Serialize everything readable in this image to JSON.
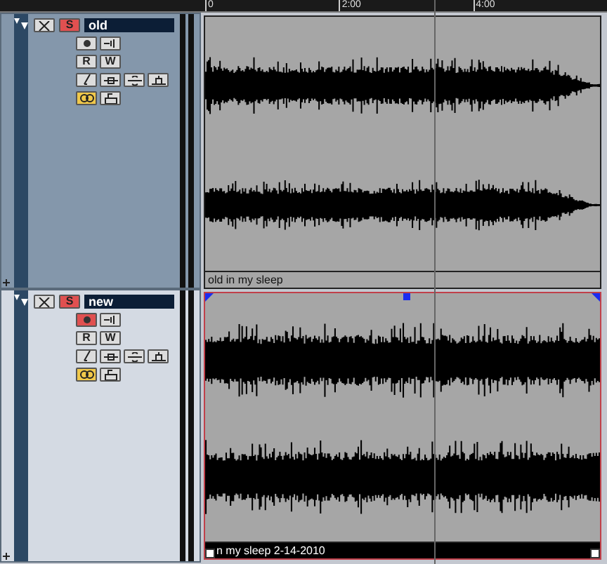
{
  "ruler": {
    "ticks": [
      {
        "label": "0"
      },
      {
        "label": "2:00"
      },
      {
        "label": "4:00"
      }
    ]
  },
  "tracks": [
    {
      "name": "old",
      "selected": false,
      "solo_label": "S",
      "read_label": "R",
      "write_label": "W",
      "record": false,
      "lanes": true,
      "event": {
        "label": "old in my sleep",
        "selected": false
      }
    },
    {
      "name": "new",
      "selected": true,
      "solo_label": "S",
      "read_label": "R",
      "write_label": "W",
      "record": true,
      "lanes": true,
      "event": {
        "label": "n my sleep 2-14-2010",
        "selected": true
      }
    }
  ]
}
